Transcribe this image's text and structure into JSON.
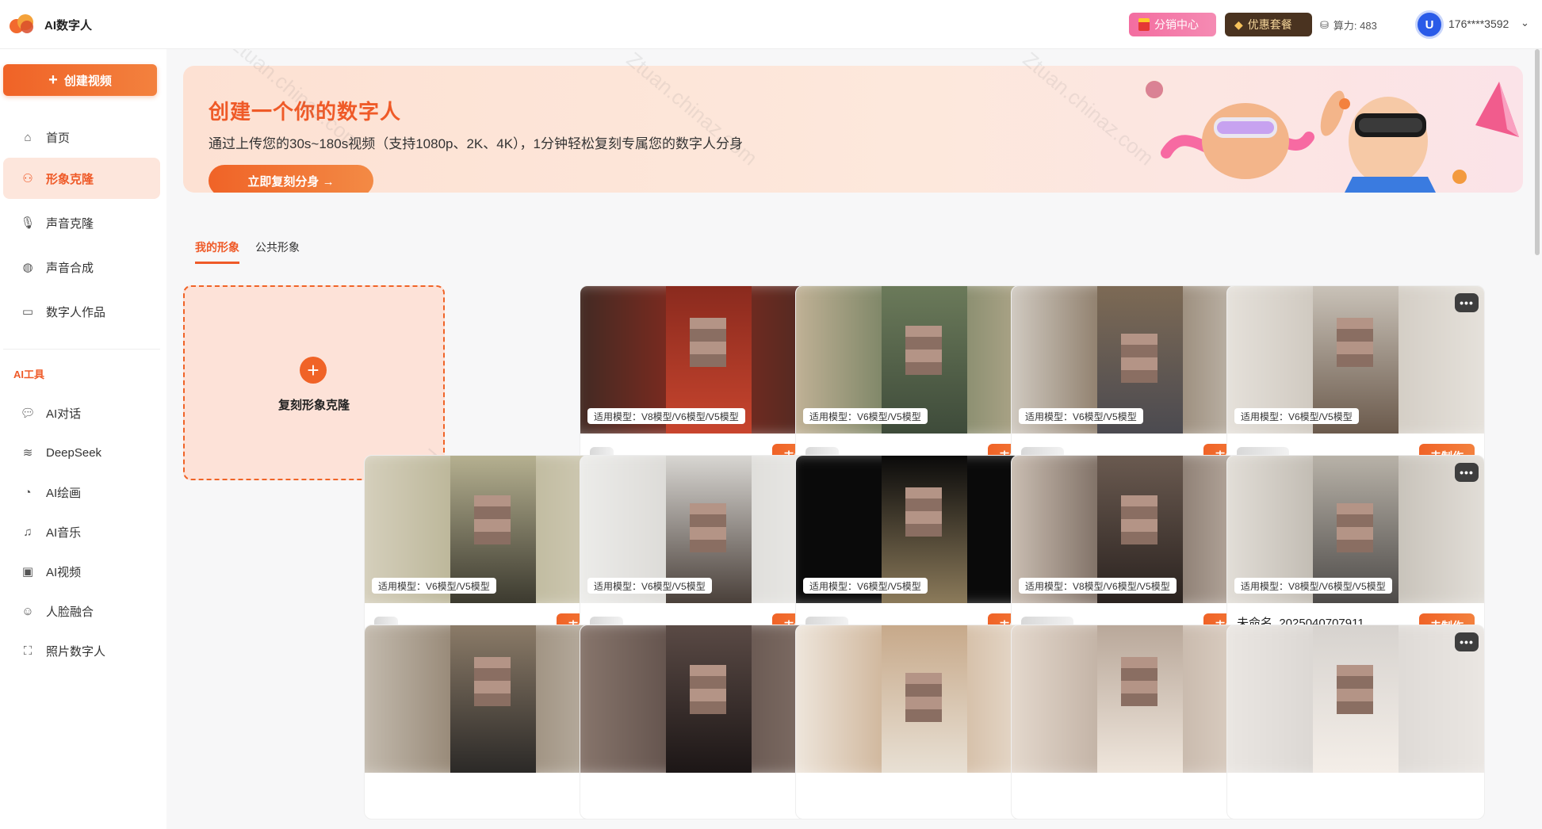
{
  "app": {
    "title": "AI数字人"
  },
  "header": {
    "distribution_label": "分销中心",
    "package_label": "优惠套餐",
    "power_label": "算力: 483",
    "avatar_letter": "U",
    "user_phone": "176****3592"
  },
  "sidebar": {
    "create_label": "创建视频",
    "items": [
      {
        "label": "首页",
        "icon": "home-icon"
      },
      {
        "label": "形象克隆",
        "icon": "user-clone-icon"
      },
      {
        "label": "声音克隆",
        "icon": "mic-icon"
      },
      {
        "label": "声音合成",
        "icon": "sound-wave-icon"
      },
      {
        "label": "数字人作品",
        "icon": "video-icon"
      }
    ],
    "section_label": "AI工具",
    "tools": [
      {
        "label": "AI对话",
        "icon": "chat-icon"
      },
      {
        "label": "DeepSeek",
        "icon": "whale-icon"
      },
      {
        "label": "AI绘画",
        "icon": "palette-icon"
      },
      {
        "label": "AI音乐",
        "icon": "music-icon"
      },
      {
        "label": "AI视频",
        "icon": "film-icon"
      },
      {
        "label": "人脸融合",
        "icon": "face-icon"
      },
      {
        "label": "照片数字人",
        "icon": "photo-person-icon"
      }
    ]
  },
  "banner": {
    "title": "创建一个你的数字人",
    "description": "通过上传您的30s~180s视频（支持1080p、2K、4K），1分钟轻松复刻专属您的数字人分身",
    "button_label": "立即复刻分身 →"
  },
  "tabs": [
    {
      "label": "我的形象"
    },
    {
      "label": "公共形象"
    }
  ],
  "add_card": {
    "label": "复刻形象克隆"
  },
  "cards": [
    {
      "tag": "适用模型：V8模型/V6模型/V5模型",
      "name": "",
      "button": "去制作"
    },
    {
      "tag": "适用模型：V6模型/V5模型",
      "name": "",
      "button": "去制作"
    },
    {
      "tag": "适用模型：V6模型/V5模型",
      "name": "",
      "button": "去制作"
    },
    {
      "tag": "适用模型：V6模型/V5模型",
      "name": "",
      "button": "去制作"
    },
    {
      "tag": "适用模型：V6模型/V5模型",
      "name": "",
      "button": "去制作"
    },
    {
      "tag": "适用模型：V6模型/V5模型",
      "name": "",
      "button": "去制作"
    },
    {
      "tag": "适用模型：V6模型/V5模型",
      "name": "",
      "button": "去制作"
    },
    {
      "tag": "适用模型：V8模型/V6模型/V5模型",
      "name": "",
      "button": "去制作"
    },
    {
      "tag": "适用模型：V8模型/V6模型/V5模型",
      "name": "未命名_2025040707911",
      "button": "去制作"
    },
    {
      "tag": "",
      "name": "",
      "button": ""
    },
    {
      "tag": "",
      "name": "",
      "button": ""
    },
    {
      "tag": "",
      "name": "",
      "button": ""
    },
    {
      "tag": "",
      "name": "",
      "button": ""
    },
    {
      "tag": "",
      "name": "",
      "button": ""
    }
  ],
  "more_label": "•••",
  "colors": {
    "accent": "#ef5a28",
    "accent_light": "#fde2d8",
    "pink": "#f36da0",
    "dark_gold": "#4a3320"
  }
}
